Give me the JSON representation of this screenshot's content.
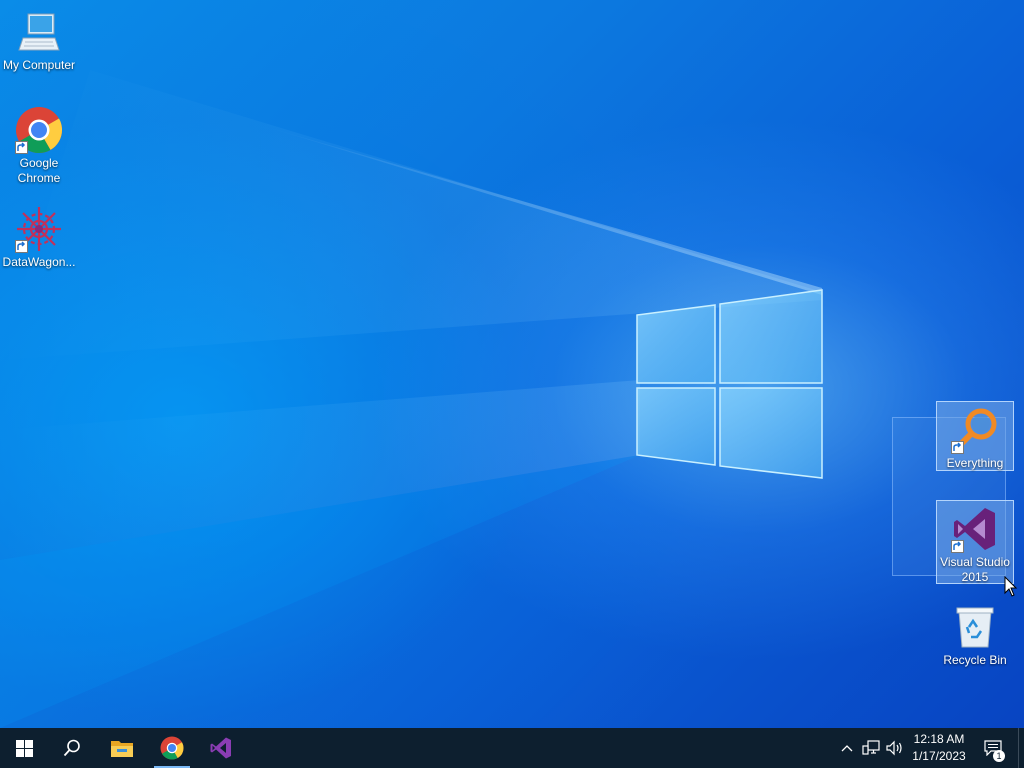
{
  "desktop": {
    "icons": [
      {
        "label": "My Computer",
        "icon": "computer-icon",
        "shortcut": false,
        "selected": false
      },
      {
        "label": "Google\nChrome",
        "icon": "chrome-icon",
        "shortcut": true,
        "selected": false
      },
      {
        "label": "DataWagon...",
        "icon": "datawagon-icon",
        "shortcut": true,
        "selected": false
      },
      {
        "label": "Everything",
        "icon": "everything-search-icon",
        "shortcut": true,
        "selected": true
      },
      {
        "label": "Visual Studio\n2015",
        "icon": "visual-studio-icon",
        "shortcut": true,
        "selected": true
      },
      {
        "label": "Recycle Bin",
        "icon": "recycle-bin-icon",
        "shortcut": false,
        "selected": false
      }
    ]
  },
  "taskbar": {
    "pinned": [
      {
        "name": "start-button",
        "icon": "windows-logo-icon"
      },
      {
        "name": "search-button",
        "icon": "search-icon"
      },
      {
        "name": "file-explorer-button",
        "icon": "folder-icon"
      },
      {
        "name": "chrome-taskbar-button",
        "icon": "chrome-icon"
      },
      {
        "name": "visual-studio-taskbar-button",
        "icon": "visual-studio-icon"
      }
    ],
    "clock": {
      "time": "12:18 AM",
      "date": "1/17/2023"
    },
    "notifications_count": "1"
  },
  "colors": {
    "taskbar": "#0d1f2f",
    "wallpaper_accent": "#0a63d8",
    "vs_purple": "#68217a",
    "everything_orange": "#f08a24"
  }
}
